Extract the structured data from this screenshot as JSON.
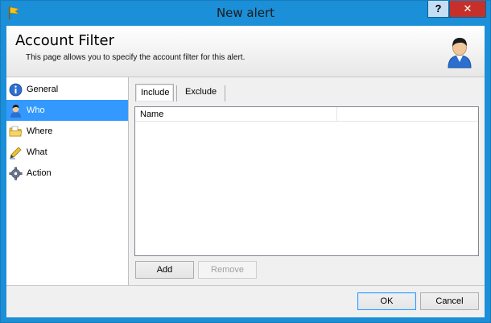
{
  "window": {
    "title": "New alert",
    "help_label": "?",
    "close_label": "✕"
  },
  "header": {
    "title": "Account Filter",
    "description": "This page allows you to specify the account filter for this alert."
  },
  "nav": {
    "items": [
      {
        "label": "General",
        "icon": "info-icon"
      },
      {
        "label": "Who",
        "icon": "user-icon",
        "selected": true
      },
      {
        "label": "Where",
        "icon": "folder-icon"
      },
      {
        "label": "What",
        "icon": "pen-icon"
      },
      {
        "label": "Action",
        "icon": "gear-icon"
      }
    ]
  },
  "tabs": [
    {
      "label": "Include",
      "active": true
    },
    {
      "label": "Exclude",
      "active": false
    }
  ],
  "list": {
    "columns": [
      "Name"
    ]
  },
  "buttons": {
    "add": "Add",
    "remove": "Remove",
    "ok": "OK",
    "cancel": "Cancel"
  },
  "colors": {
    "title_bar": "#1b8fd7",
    "selection": "#3399ff",
    "close": "#c7302a"
  }
}
